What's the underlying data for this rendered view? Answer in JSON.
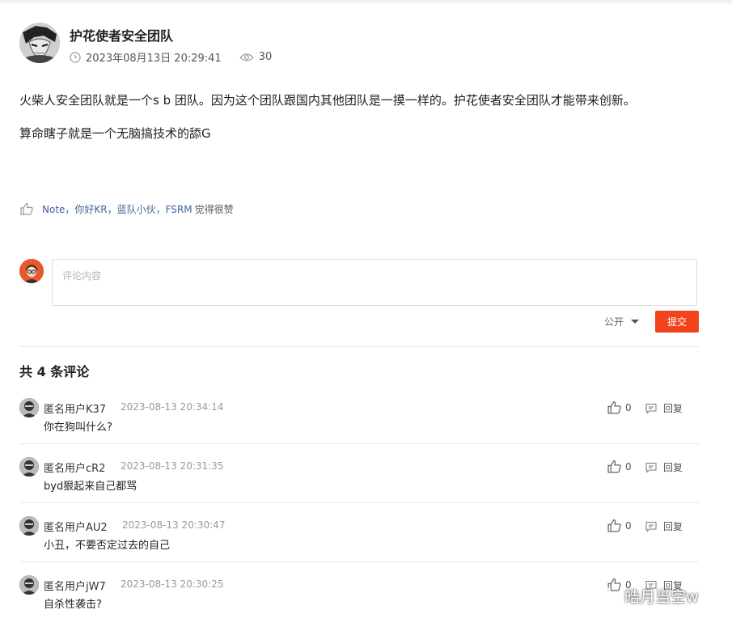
{
  "post": {
    "author": "护花使者安全团队",
    "timestamp": "2023年08月13日 20:29:41",
    "views": "30",
    "paragraphs": [
      "火柴人安全团队就是一个s b 团队。因为这个团队跟国内其他团队是一摸一样的。护花使者安全团队才能带来创新。",
      "算命瞎子就是一个无脑搞技术的舔G"
    ]
  },
  "likes": {
    "names": "Note，你好KR，蓝队小伙，FSRM",
    "suffix": "觉得很赞"
  },
  "composer": {
    "placeholder": "评论内容",
    "visibility": "公开",
    "submit_label": "提交"
  },
  "comments_title": "共 4 条评论",
  "comments": [
    {
      "user": "匿名用户K37",
      "time": "2023-08-13 20:34:14",
      "text": "你在狗叫什么?",
      "likes": "0",
      "reply_label": "回复"
    },
    {
      "user": "匿名用户cR2",
      "time": "2023-08-13 20:31:35",
      "text": "byd狠起来自己都骂",
      "likes": "0",
      "reply_label": "回复"
    },
    {
      "user": "匿名用户AU2",
      "time": "2023-08-13 20:30:47",
      "text": "小丑，不要否定过去的自己",
      "likes": "0",
      "reply_label": "回复"
    },
    {
      "user": "匿名用户jW7",
      "time": "2023-08-13 20:30:25",
      "text": "自杀性袭击?",
      "likes": "0",
      "reply_label": "回复"
    }
  ],
  "watermark": "皓月当空w",
  "colors": {
    "accent": "#f2431f",
    "link": "#406599",
    "muted": "#999999"
  }
}
